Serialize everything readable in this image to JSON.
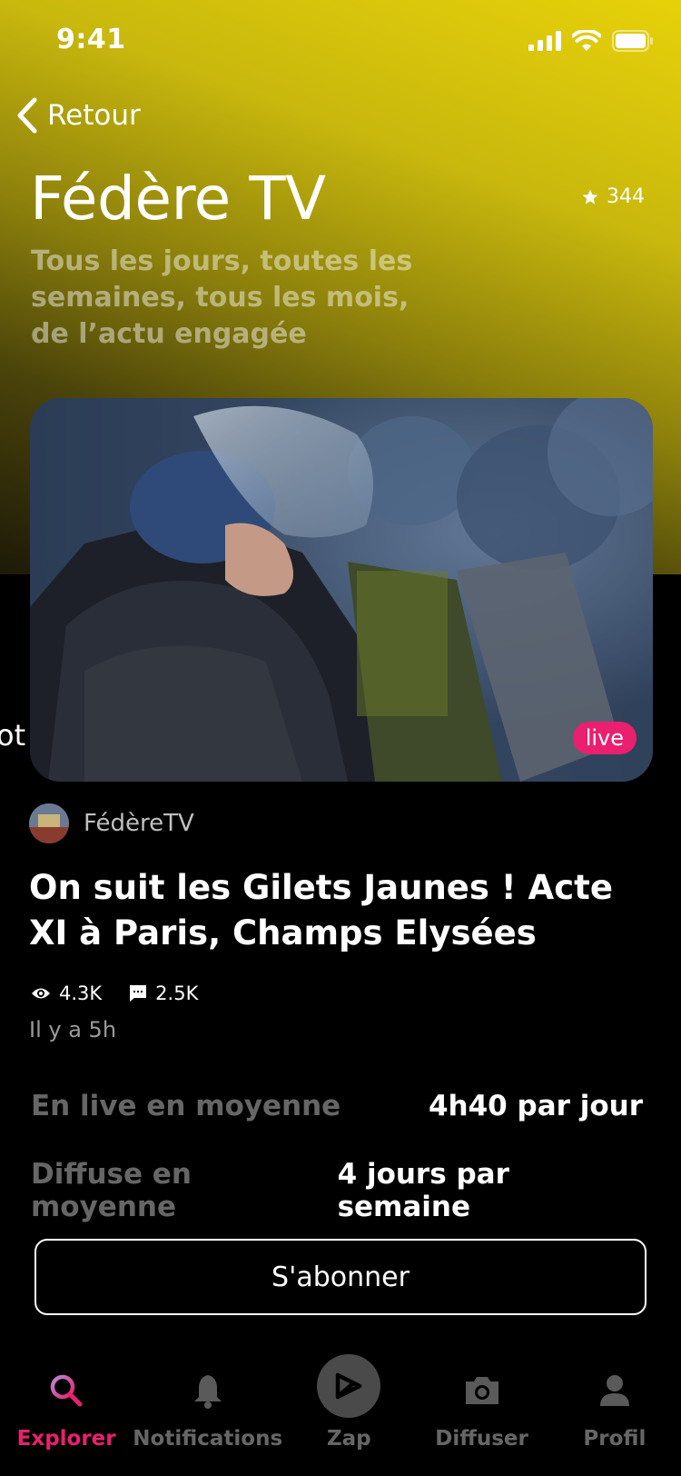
{
  "status_bar": {
    "time": "9:41"
  },
  "nav": {
    "back_label": "Retour"
  },
  "channel": {
    "title": "Fédère TV",
    "rating": "344",
    "tagline": "Tous les jours, toutes les semaines, tous les mois, de l’actu engagée"
  },
  "video": {
    "live_badge": "live",
    "side_text": "oti",
    "author": "FédèreTV",
    "title": "On suit les Gilets Jaunes ! Acte XI à Paris, Champs Elysées",
    "views": "4.3K",
    "comments": "2.5K",
    "time_ago": "Il y a 5h"
  },
  "info": [
    {
      "label": "En live en moyenne",
      "value": "4h40 par jour"
    },
    {
      "label": "Diffuse en moyenne",
      "value": "4 jours par semaine"
    }
  ],
  "subscribe_label": "S'abonner",
  "tabbar": {
    "explorer": "Explorer",
    "notifications": "Notifications",
    "zap": "Zap",
    "diffuser": "Diffuser",
    "profil": "Profil"
  },
  "colors": {
    "accent": "#ea1f6f",
    "header_yellow": "#e7d10a"
  }
}
